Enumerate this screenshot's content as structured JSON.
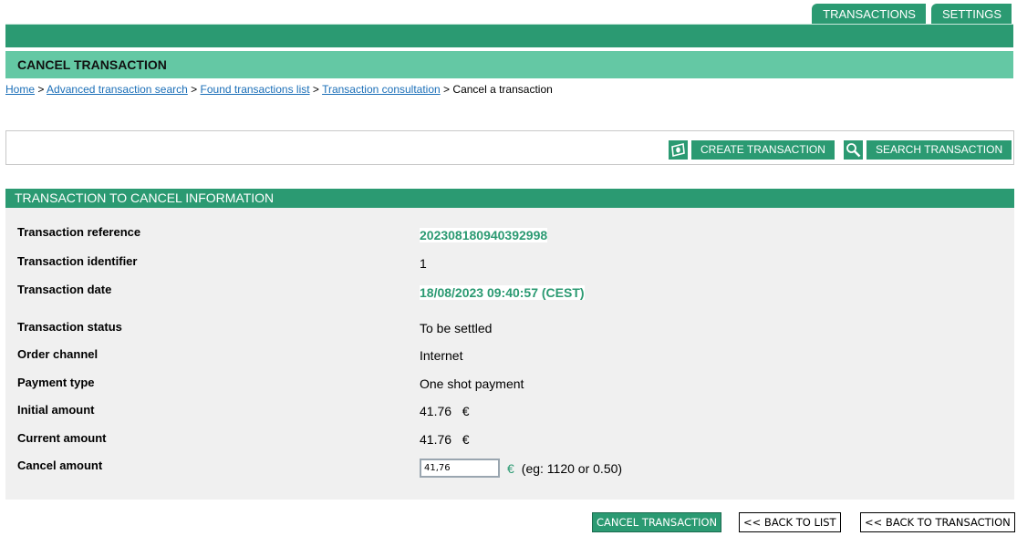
{
  "tabs": [
    {
      "label": "TRANSACTIONS"
    },
    {
      "label": "SETTINGS"
    }
  ],
  "page_title": "CANCEL TRANSACTION",
  "breadcrumb": {
    "links": [
      "Home",
      "Advanced transaction search",
      "Found transactions list",
      "Transaction consultation"
    ],
    "separator": ">",
    "current": "Cancel a transaction"
  },
  "toolbar": {
    "create_label": "CREATE TRANSACTION",
    "create_icon": "money-icon",
    "search_label": "SEARCH TRANSACTION",
    "search_icon": "magnifier-icon"
  },
  "section": {
    "title": "TRANSACTION TO CANCEL INFORMATION",
    "fields": [
      {
        "label": "Transaction reference",
        "value": "202308180940392998"
      },
      {
        "label": "Transaction identifier",
        "value": "1"
      },
      {
        "label": "Transaction date",
        "value": "18/08/2023 09:40:57 (CEST)"
      },
      {
        "label": "Transaction status",
        "value": "To be settled"
      },
      {
        "label": "Order channel",
        "value": "Internet"
      },
      {
        "label": "Payment type",
        "value": "One shot payment"
      },
      {
        "label": "Initial amount",
        "value": "41.76",
        "currency": "€"
      },
      {
        "label": "Current amount",
        "value": "41.76",
        "currency": "€"
      },
      {
        "label": "Cancel amount",
        "input_value": "41,76",
        "currency": "€",
        "hint": "(eg: 1120 or 0.50)"
      }
    ]
  },
  "actions": {
    "cancel": "CANCEL TRANSACTION",
    "back_list": "<< BACK TO LIST",
    "back_transaction": "<< BACK TO TRANSACTION"
  },
  "colors": {
    "primary": "#2b9a72",
    "title_bar": "#64c8a4",
    "link": "#1b6fb8",
    "panel_bg": "#f0f0f0"
  }
}
